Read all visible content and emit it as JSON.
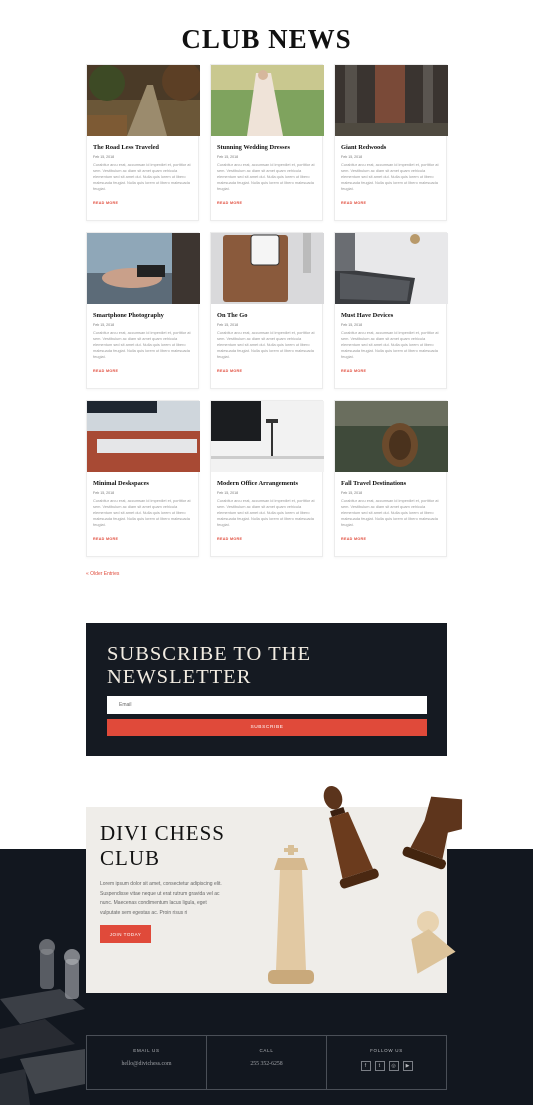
{
  "page": {
    "title": "CLUB NEWS",
    "older_entries": "« Older Entries"
  },
  "posts": [
    {
      "title": "The Road Less Traveled",
      "date": "Feb 15, 2018",
      "excerpt": "Curabitur arcu erat, accumsan id imperdiet et, porttitor at sem. Vestibulum ac diam sit amet quam vehicula elementum sed sit amet dui. Nulla quis lorem ut libero malesuada feugiat. Nulla quis lorem ut libero malesuada feugiat.",
      "read_more": "READ MORE",
      "image_icon": "forest-road-photo"
    },
    {
      "title": "Stunning Wedding Dresses",
      "date": "Feb 15, 2018",
      "excerpt": "Curabitur arcu erat, accumsan id imperdiet et, porttitor at sem. Vestibulum ac diam sit amet quam vehicula elementum sed sit amet dui. Nulla quis lorem ut libero malesuada feugiat. Nulla quis lorem ut libero malesuada feugiat.",
      "read_more": "READ MORE",
      "image_icon": "wedding-dress-photo"
    },
    {
      "title": "Giant Redwoods",
      "date": "Feb 15, 2018",
      "excerpt": "Curabitur arcu erat, accumsan id imperdiet et, porttitor at sem. Vestibulum ac diam sit amet quam vehicula elementum sed sit amet dui. Nulla quis lorem ut libero malesuada feugiat. Nulla quis lorem ut libero malesuada feugiat.",
      "read_more": "READ MORE",
      "image_icon": "redwood-photo"
    },
    {
      "title": "Smartphone Photography",
      "date": "Feb 15, 2018",
      "excerpt": "Curabitur arcu erat, accumsan id imperdiet et, porttitor at sem. Vestibulum ac diam sit amet quam vehicula elementum sed sit amet dui. Nulla quis lorem ut libero malesuada feugiat. Nulla quis lorem ut libero malesuada feugiat.",
      "read_more": "READ MORE",
      "image_icon": "smartphone-photo"
    },
    {
      "title": "On The Go",
      "date": "Feb 15, 2018",
      "excerpt": "Curabitur arcu erat, accumsan id imperdiet et, porttitor at sem. Vestibulum ac diam sit amet quam vehicula elementum sed sit amet dui. Nulla quis lorem ut libero malesuada feugiat. Nulla quis lorem ut libero malesuada feugiat.",
      "read_more": "READ MORE",
      "image_icon": "phone-case-photo"
    },
    {
      "title": "Must Have Devices",
      "date": "Feb 15, 2018",
      "excerpt": "Curabitur arcu erat, accumsan id imperdiet et, porttitor at sem. Vestibulum ac diam sit amet quam vehicula elementum sed sit amet dui. Nulla quis lorem ut libero malesuada feugiat. Nulla quis lorem ut libero malesuada feugiat.",
      "read_more": "READ MORE",
      "image_icon": "laptop-photo"
    },
    {
      "title": "Minimal Deskspaces",
      "date": "Feb 15, 2018",
      "excerpt": "Curabitur arcu erat, accumsan id imperdiet et, porttitor at sem. Vestibulum ac diam sit amet quam vehicula elementum sed sit amet dui. Nulla quis lorem ut libero malesuada feugiat. Nulla quis lorem ut libero malesuada feugiat.",
      "read_more": "READ MORE",
      "image_icon": "keyboard-desk-photo"
    },
    {
      "title": "Modern Office Arrangements",
      "date": "Feb 15, 2018",
      "excerpt": "Curabitur arcu erat, accumsan id imperdiet et, porttitor at sem. Vestibulum ac diam sit amet quam vehicula elementum sed sit amet dui. Nulla quis lorem ut libero malesuada feugiat. Nulla quis lorem ut libero malesuada feugiat.",
      "read_more": "READ MORE",
      "image_icon": "office-monitor-photo"
    },
    {
      "title": "Fall Travel Destinations",
      "date": "Feb 15, 2018",
      "excerpt": "Curabitur arcu erat, accumsan id imperdiet et, porttitor at sem. Vestibulum ac diam sit amet quam vehicula elementum sed sit amet dui. Nulla quis lorem ut libero malesuada feugiat. Nulla quis lorem ut libero malesuada feugiat.",
      "read_more": "READ MORE",
      "image_icon": "pinecone-photo"
    }
  ],
  "newsletter": {
    "title": "SUBSCRIBE TO THE NEWSLETTER",
    "email_placeholder": "Email",
    "button_label": "SUBSCRIBE"
  },
  "club": {
    "title": "DIVI CHESS CLUB",
    "text": "Lorem ipsum dolor sit amet, consectetur adipiscing elit. Suspendisse vitae neque ut erat rutrum gravida vel ac nunc. Maecenas condimentum lacus ligula, eget vulputate sem egestas ac. Proin risus ri",
    "button_label": "JOIN TODAY"
  },
  "footer": {
    "email_heading": "EMAIL US",
    "email_value": "hello@divichess.com",
    "call_heading": "CALL",
    "call_value": "255 352-6258",
    "follow_heading": "FOLLOW US",
    "socials": [
      {
        "icon": "facebook-icon",
        "glyph": "f"
      },
      {
        "icon": "twitter-icon",
        "glyph": "t"
      },
      {
        "icon": "instagram-icon",
        "glyph": "◎"
      },
      {
        "icon": "youtube-icon",
        "glyph": "▶"
      }
    ]
  },
  "colors": {
    "accent": "#e04a3a",
    "dark": "#151a22",
    "panel": "#efede9"
  }
}
